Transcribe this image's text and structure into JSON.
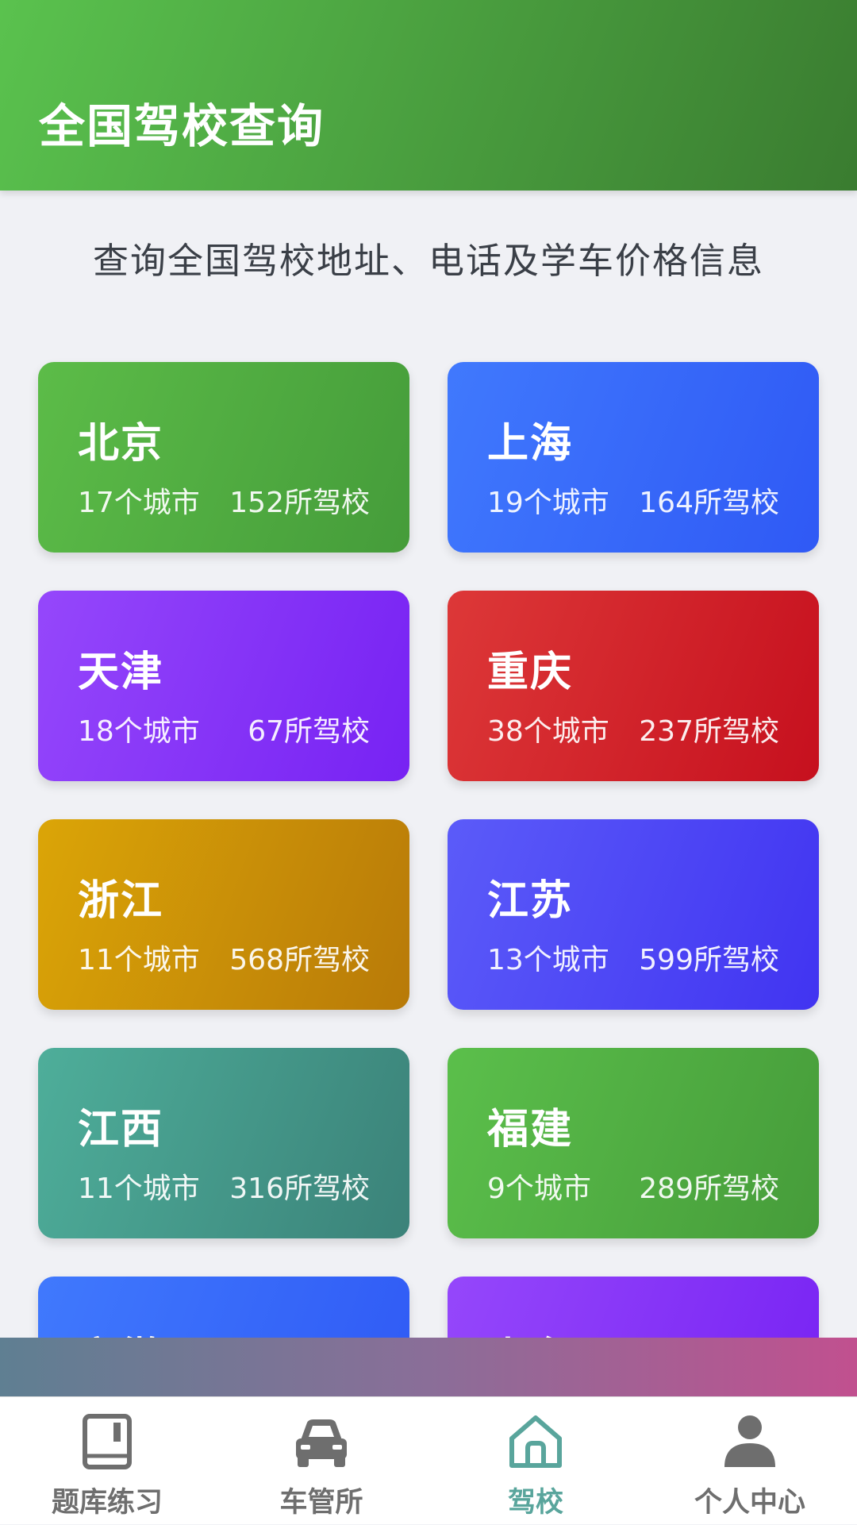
{
  "header": {
    "title": "全国驾校查询"
  },
  "subtitle": "查询全国驾校地址、电话及学车价格信息",
  "provinces": [
    {
      "name": "北京",
      "cities": "17个城市",
      "schools": "152所驾校",
      "color_from": "#5cbc48",
      "color_to": "#459c3a"
    },
    {
      "name": "上海",
      "cities": "19个城市",
      "schools": "164所驾校",
      "color_from": "#4079fd",
      "color_to": "#2f59f5"
    },
    {
      "name": "天津",
      "cities": "18个城市",
      "schools": "67所驾校",
      "color_from": "#9547fb",
      "color_to": "#7722f3"
    },
    {
      "name": "重庆",
      "cities": "38个城市",
      "schools": "237所驾校",
      "color_from": "#dd3838",
      "color_to": "#c6101e"
    },
    {
      "name": "浙江",
      "cities": "11个城市",
      "schools": "568所驾校",
      "color_from": "#dba507",
      "color_to": "#b87a08"
    },
    {
      "name": "江苏",
      "cities": "13个城市",
      "schools": "599所驾校",
      "color_from": "#5b5bf9",
      "color_to": "#4134f1"
    },
    {
      "name": "江西",
      "cities": "11个城市",
      "schools": "316所驾校",
      "color_from": "#4eae9a",
      "color_to": "#3b8279"
    },
    {
      "name": "福建",
      "cities": "9个城市",
      "schools": "289所驾校",
      "color_from": "#5bbf4b",
      "color_to": "#469c3a"
    },
    {
      "name": "安徽",
      "cities": "",
      "schools": "",
      "color_from": "#4079fd",
      "color_to": "#2f59f5"
    },
    {
      "name": "山东",
      "cities": "",
      "schools": "",
      "color_from": "#9547fb",
      "color_to": "#7722f3"
    }
  ],
  "tabbar": {
    "tabs": [
      {
        "label": "题库练习",
        "icon": "book-icon",
        "active": false
      },
      {
        "label": "车管所",
        "icon": "car-icon",
        "active": false
      },
      {
        "label": "驾校",
        "icon": "home-icon",
        "active": true
      },
      {
        "label": "个人中心",
        "icon": "person-icon",
        "active": false
      }
    ],
    "active_color": "#59a59c",
    "inactive_color": "#6e6e6e"
  }
}
